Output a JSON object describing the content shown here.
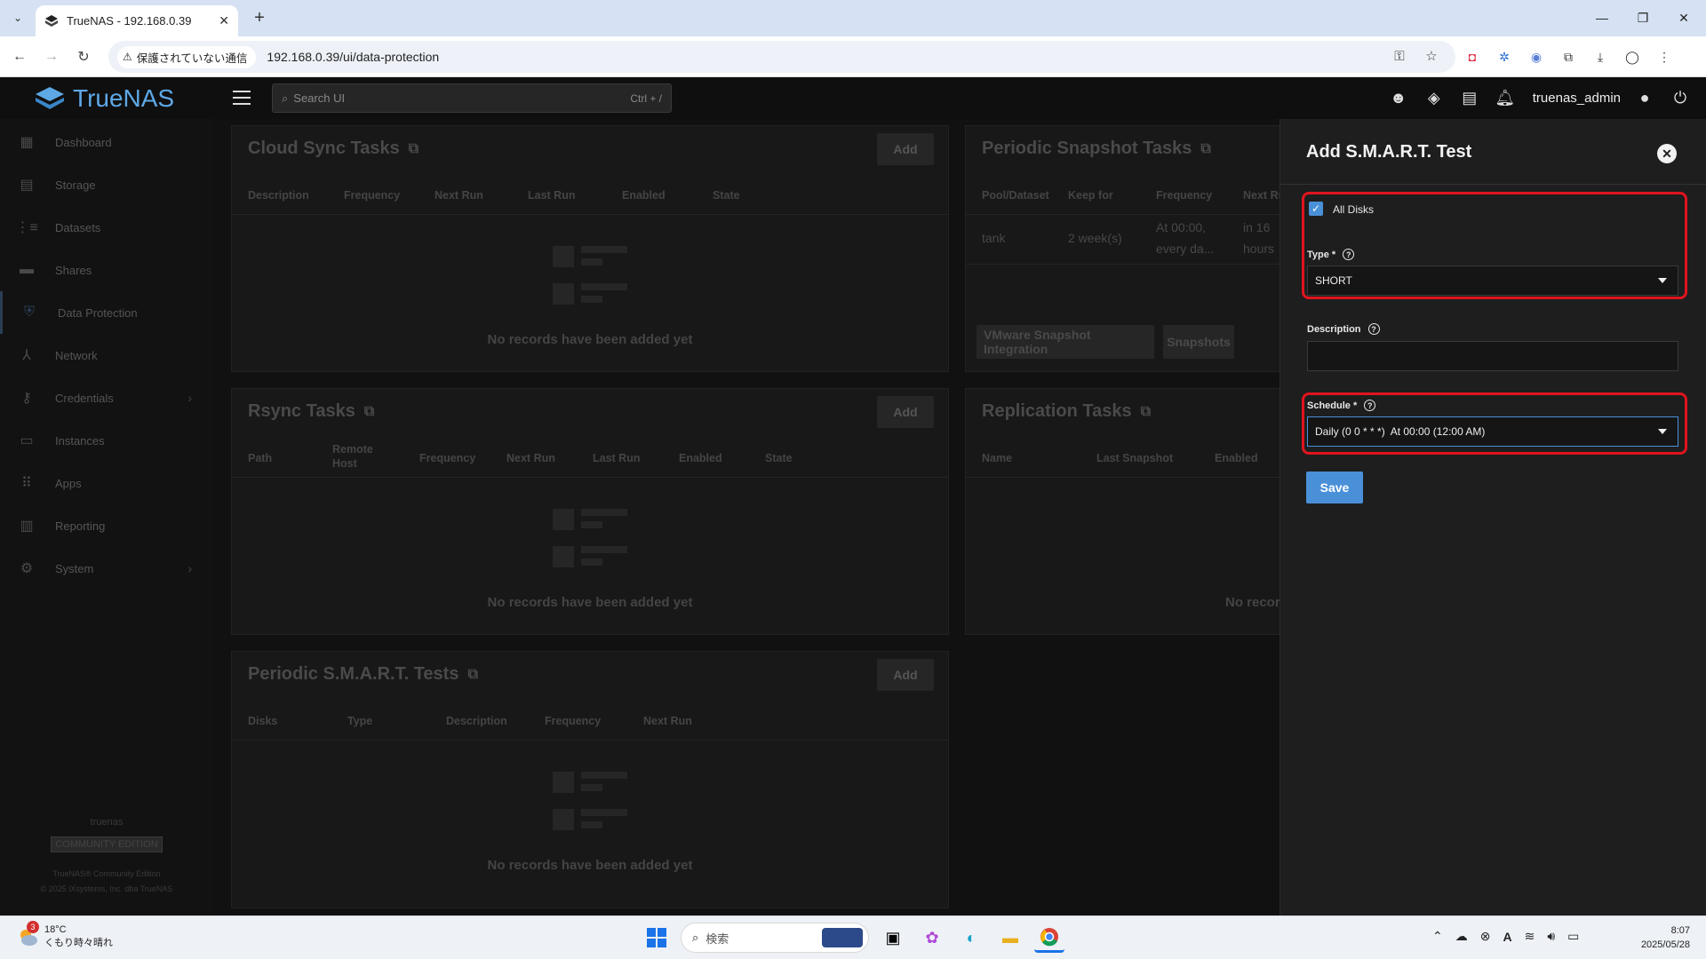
{
  "browser": {
    "tab_title": "TrueNAS - 192.168.0.39",
    "security_label": "保護されていない通信",
    "url": "192.168.0.39/ui/data-protection"
  },
  "header": {
    "brand": "TrueNAS",
    "search_placeholder": "Search UI",
    "search_shortcut": "Ctrl + /",
    "username": "truenas_admin"
  },
  "sidebar": {
    "items": [
      {
        "label": "Dashboard",
        "icon": "dashboard-icon"
      },
      {
        "label": "Storage",
        "icon": "storage-icon"
      },
      {
        "label": "Datasets",
        "icon": "datasets-icon"
      },
      {
        "label": "Shares",
        "icon": "shares-icon"
      },
      {
        "label": "Data Protection",
        "icon": "shield-icon"
      },
      {
        "label": "Network",
        "icon": "network-icon"
      },
      {
        "label": "Credentials",
        "icon": "key-icon"
      },
      {
        "label": "Instances",
        "icon": "laptop-icon"
      },
      {
        "label": "Apps",
        "icon": "apps-icon"
      },
      {
        "label": "Reporting",
        "icon": "chart-icon"
      },
      {
        "label": "System",
        "icon": "gear-icon"
      }
    ],
    "footer_host": "truenas",
    "footer_edition": "COMMUNITY EDITION",
    "footer_line1": "TrueNAS® Community Edition",
    "footer_line2": "© 2025 iXsystems, Inc. dba TrueNAS"
  },
  "cards": {
    "cloud_sync": {
      "title": "Cloud Sync Tasks",
      "add": "Add",
      "columns": [
        "Description",
        "Frequency",
        "Next Run",
        "Last Run",
        "Enabled",
        "State"
      ],
      "empty": "No records have been added yet"
    },
    "rsync": {
      "title": "Rsync Tasks",
      "add": "Add",
      "columns": [
        "Path",
        "Remote Host",
        "Frequency",
        "Next Run",
        "Last Run",
        "Enabled",
        "State"
      ],
      "empty": "No records have been added yet"
    },
    "smart": {
      "title": "Periodic S.M.A.R.T. Tests",
      "add": "Add",
      "columns": [
        "Disks",
        "Type",
        "Description",
        "Frequency",
        "Next Run"
      ],
      "empty": "No records have been added yet"
    },
    "snapshot": {
      "title": "Periodic Snapshot Tasks",
      "columns": [
        "Pool/Dataset",
        "Keep for",
        "Frequency",
        "Next Ru"
      ],
      "row": {
        "pool": "tank",
        "keep": "2 week(s)",
        "freq1": "At 00:00,",
        "freq2": "every da...",
        "next1": "in 16",
        "next2": "hours"
      },
      "btn_vmware": "VMware Snapshot Integration",
      "btn_snapshots": "Snapshots"
    },
    "replication": {
      "title": "Replication Tasks",
      "columns": [
        "Name",
        "Last Snapshot",
        "Enabled"
      ],
      "empty": "No recor"
    }
  },
  "panel": {
    "title": "Add S.M.A.R.T. Test",
    "all_disks_label": "All Disks",
    "all_disks_checked": true,
    "type_label": "Type *",
    "type_value": "SHORT",
    "description_label": "Description",
    "description_value": "",
    "schedule_label": "Schedule *",
    "schedule_value": "Daily (0 0 * * *)  At 00:00 (12:00 AM)",
    "save_label": "Save"
  },
  "taskbar": {
    "weather_temp": "18°C",
    "weather_desc": "くもり時々晴れ",
    "weather_badge": "3",
    "search_placeholder": "検索",
    "time": "8:07",
    "date": "2025/05/28"
  },
  "colors": {
    "accent": "#4a90d9",
    "highlight": "#e0141e",
    "brand": "#5ea8e6"
  }
}
